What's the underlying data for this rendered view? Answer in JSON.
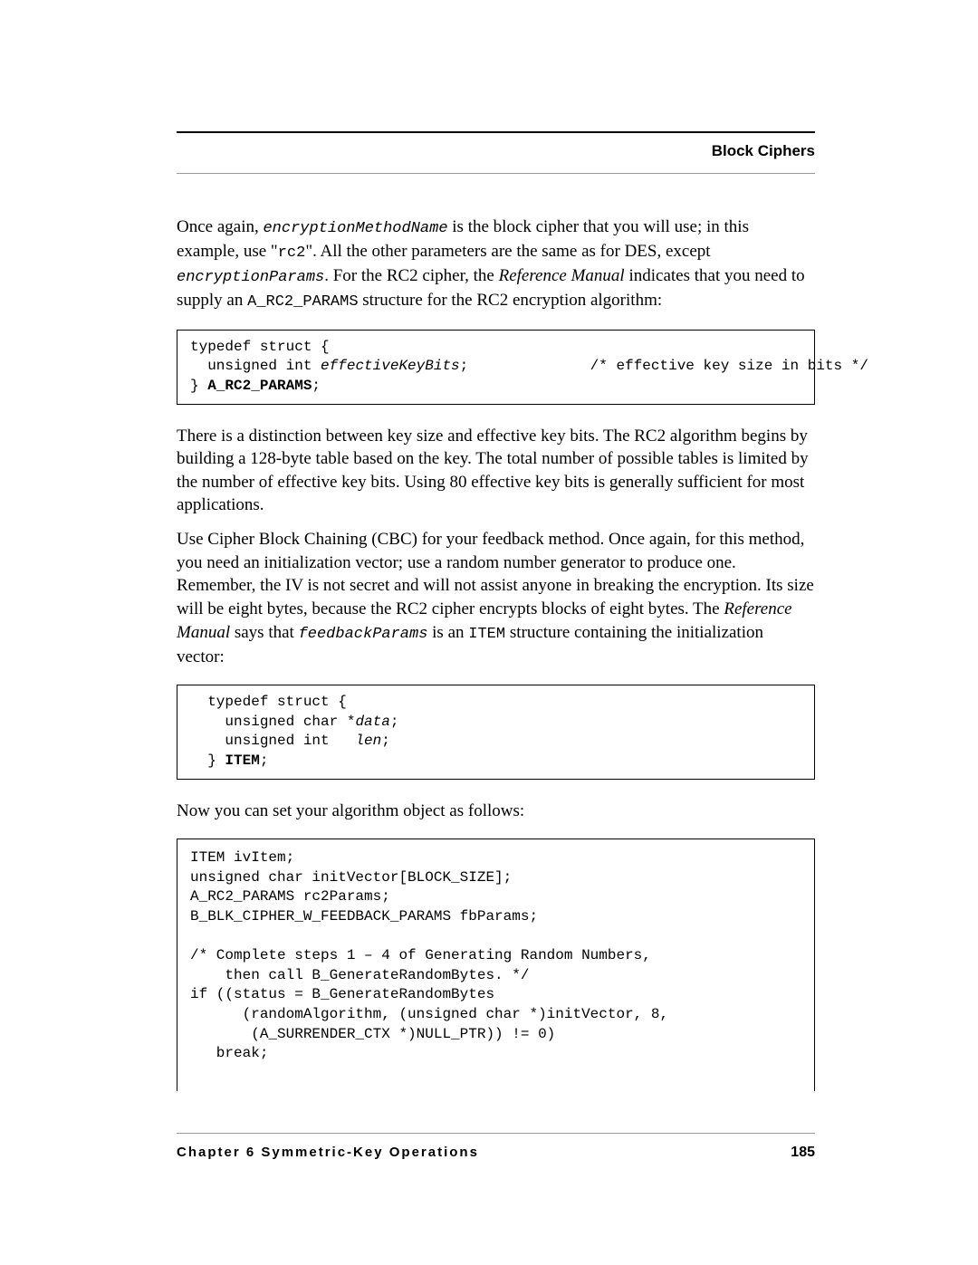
{
  "header": {
    "section_title": "Block Ciphers"
  },
  "paragraphs": {
    "p1_a": "Once again, ",
    "p1_code1": "encryptionMethodName",
    "p1_b": " is the block cipher that you will use; in this example, use \"",
    "p1_code2": "rc2",
    "p1_c": "\". All the other parameters are the same as for DES, except ",
    "p1_code3": "encryptionParams",
    "p1_d": ". For the RC2 cipher, the ",
    "p1_italic1": "Reference Manual",
    "p1_e": " indicates that you need to supply an ",
    "p1_code4": "A_RC2_PARAMS",
    "p1_f": " structure for the RC2 encryption algorithm:",
    "p2": "There is a distinction between key size and effective key bits. The RC2 algorithm begins by building a 128-byte table based on the key. The total number of possible tables is limited by the number of effective key bits. Using 80 effective key bits is generally sufficient for most applications.",
    "p3_a": "Use Cipher Block Chaining (CBC) for your feedback method. Once again, for this method, you need an initialization vector; use a random number generator to produce one. Remember, the IV is not secret and will not assist anyone in breaking the encryption. Its size will be eight bytes, because the RC2 cipher encrypts blocks of eight bytes. The ",
    "p3_italic1": "Reference Manual",
    "p3_b": " says that ",
    "p3_code1": "feedbackParams",
    "p3_c": " is an ",
    "p3_code2": "ITEM",
    "p3_d": " structure containing the initialization vector:",
    "p4": "Now you can set your algorithm object as follows:"
  },
  "code_blocks": {
    "block1_line1": "typedef struct {",
    "block1_line2a": "  unsigned int ",
    "block1_line2b": "effectiveKeyBits",
    "block1_line2c": ";              /* effective key size in bits */",
    "block1_line3a": "} ",
    "block1_line3b": "A_RC2_PARAMS",
    "block1_line3c": ";",
    "block2_line1": "  typedef struct {",
    "block2_line2a": "    unsigned char *",
    "block2_line2b": "data",
    "block2_line2c": ";",
    "block2_line3a": "    unsigned int   ",
    "block2_line3b": "len",
    "block2_line3c": ";",
    "block2_line4a": "  } ",
    "block2_line4b": "ITEM",
    "block2_line4c": ";",
    "block3": "ITEM ivItem;\nunsigned char initVector[BLOCK_SIZE];\nA_RC2_PARAMS rc2Params;\nB_BLK_CIPHER_W_FEEDBACK_PARAMS fbParams;\n\n/* Complete steps 1 – 4 of Generating Random Numbers,\n    then call B_GenerateRandomBytes. */\nif ((status = B_GenerateRandomBytes\n      (randomAlgorithm, (unsigned char *)initVector, 8,\n       (A_SURRENDER_CTX *)NULL_PTR)) != 0)\n   break;"
  },
  "footer": {
    "chapter_label": "Chapter 6  Symmetric-Key Operations",
    "page_number": "185"
  }
}
